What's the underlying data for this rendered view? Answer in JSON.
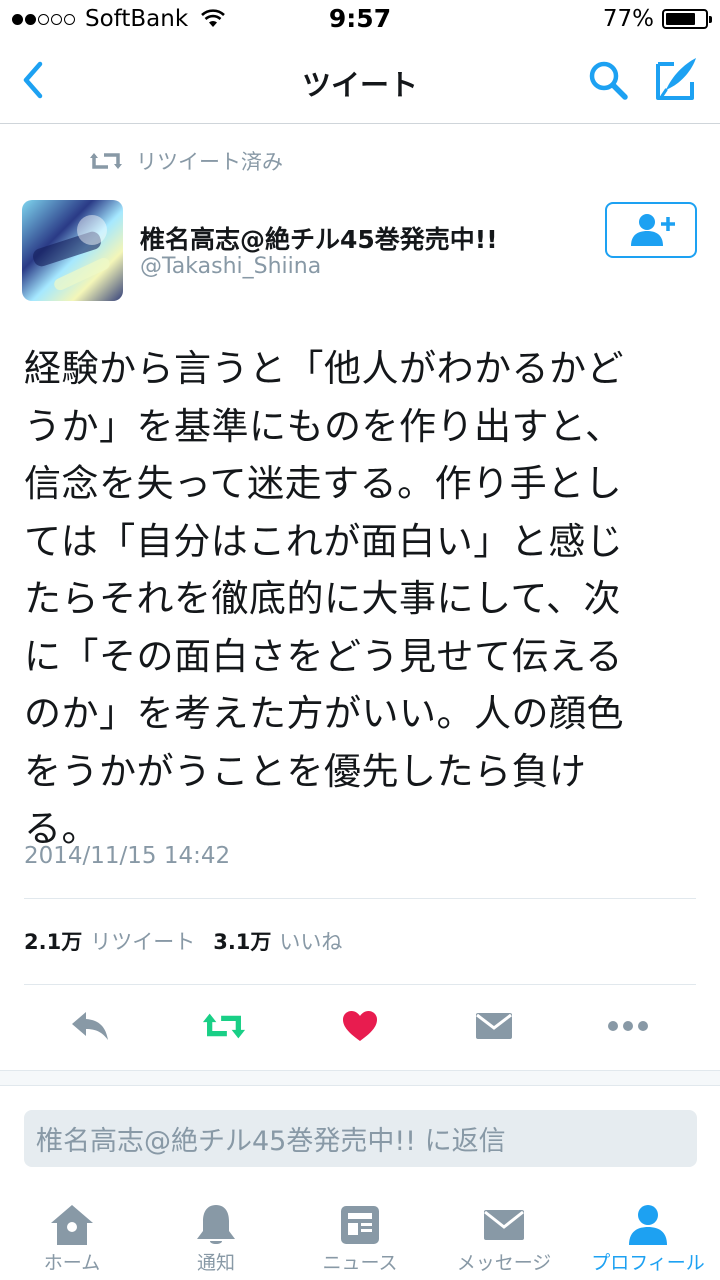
{
  "status_bar": {
    "carrier": "SoftBank",
    "time": "9:57",
    "battery_percent": "77%",
    "signal_bars_filled": 2,
    "signal_bars_total": 5,
    "battery_level": 0.77
  },
  "nav": {
    "title": "ツイート",
    "back_icon": "chevron-left-icon",
    "search_icon": "search-icon",
    "compose_icon": "compose-icon"
  },
  "tweet": {
    "retweeted_label": "リツイート済み",
    "author": {
      "display_name": "椎名高志@絶チル45巻発売中!!",
      "handle": "@Takashi_Shiina"
    },
    "text_lines": [
      "経験から言うと「他人がわかるかど",
      "うか」を基準にものを作り出すと、",
      "信念を失って迷走する。作り手とし",
      "ては「自分はこれが面白い」と感じ",
      "たらそれを徹底的に大事にして、次",
      "に「その面白さをどう見せて伝える",
      "のか」を考えた方がいい。人の顔色",
      "をうかがうことを優先したら負け",
      "る。"
    ],
    "timestamp": "2014/11/15 14:42",
    "stats": {
      "retweets_count": "2.1万",
      "retweets_label": "リツイート",
      "likes_count": "3.1万",
      "likes_label": "いいね"
    }
  },
  "reply": {
    "placeholder": "椎名高志@絶チル45巻発売中!! に返信"
  },
  "tab_bar": {
    "tabs": [
      {
        "label": "ホーム",
        "icon": "home-icon"
      },
      {
        "label": "通知",
        "icon": "bell-icon"
      },
      {
        "label": "ニュース",
        "icon": "news-icon"
      },
      {
        "label": "メッセージ",
        "icon": "envelope-icon"
      },
      {
        "label": "プロフィール",
        "icon": "profile-icon"
      }
    ],
    "active_tab": "プロフィール"
  },
  "colors": {
    "accent": "#1da1f2",
    "retweet_green": "#19cf86",
    "like_red": "#e81c4f",
    "muted": "#8899a6"
  }
}
